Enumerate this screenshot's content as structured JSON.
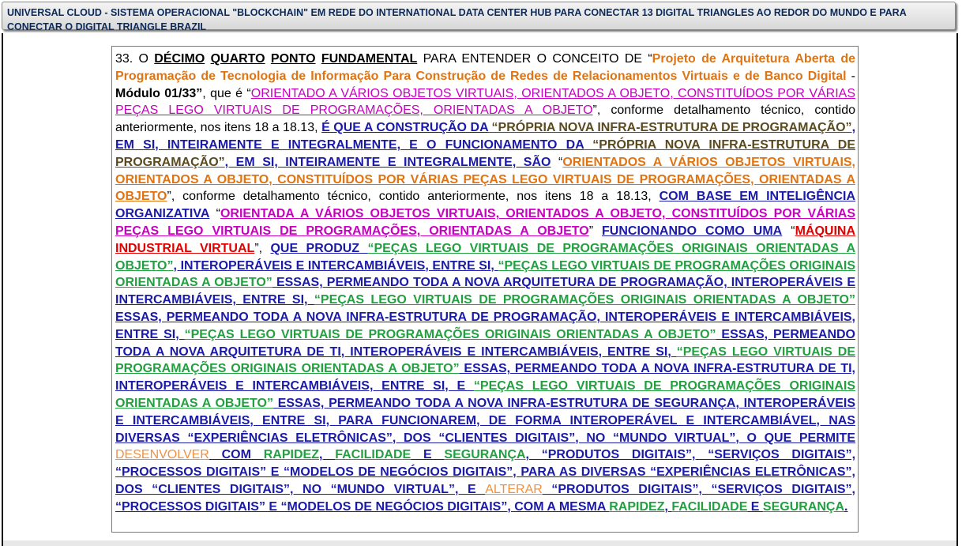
{
  "header": {
    "title": "UNIVERSAL CLOUD - SISTEMA OPERACIONAL \"BLOCKCHAIN\" EM REDE DO INTERNATIONAL DATA CENTER HUB PARA CONECTAR 13 DIGITAL TRIANGLES AO REDOR DO MUNDO E PARA CONECTAR O DIGITAL TRIANGLE BRAZIL"
  },
  "document": {
    "segments": [
      {
        "style": "plain",
        "text": "33.    O "
      },
      {
        "style": "plainu",
        "text": "DÉCIMO"
      },
      {
        "style": "plain",
        "text": " "
      },
      {
        "style": "plainu",
        "text": "QUARTO"
      },
      {
        "style": "plain",
        "text": " "
      },
      {
        "style": "plainu",
        "text": "PONTO"
      },
      {
        "style": "plain",
        "text": " "
      },
      {
        "style": "plainu",
        "text": "FUNDAMENTAL"
      },
      {
        "style": "plain",
        "text": " PARA ENTENDER O CONCEITO DE “"
      },
      {
        "style": "orangeb",
        "text": "Projeto de Arquitetura Aberta de Programação de Tecnologia de Informação Para Construção de Redes de Relacionamentos Virtuais e de Banco Digital"
      },
      {
        "style": "plain",
        "text": " - "
      },
      {
        "style": "bold",
        "text": "Módulo 01/33”"
      },
      {
        "style": "plain",
        "text": ", que é “"
      },
      {
        "style": "magenta",
        "text": "ORIENTADO A VÁRIOS OBJETOS VIRTUAIS, ORIENTADOS A OBJETO, CONSTITUÍDOS POR VÁRIAS PEÇAS LEGO VIRTUAIS DE PROGRAMAÇÕES, ORIENTADAS A OBJETO"
      },
      {
        "style": "plain",
        "text": "”, conforme detalhamento técnico, contido anteriormente, nos itens 18 a 18.13, "
      },
      {
        "style": "blue",
        "text": "É QUE A CONSTRUÇÃO DA"
      },
      {
        "style": "olive",
        "text": " “PRÓPRIA NOVA INFRA-ESTRUTURA DE PROGRAMAÇÃO”"
      },
      {
        "style": "blue",
        "text": ", EM SI, INTEIRAMENTE E INTEGRALMENTE, E O FUNCIONAMENTO DA"
      },
      {
        "style": "olive",
        "text": " “PRÓPRIA NOVA INFRA-ESTRUTURA DE PROGRAMAÇÃO”"
      },
      {
        "style": "blue",
        "text": ", EM SI, INTEIRAMENTE E INTEGRALMENTE, SÃO"
      },
      {
        "style": "plain",
        "text": " “"
      },
      {
        "style": "orange",
        "text": "ORIENTADOS A VÁRIOS OBJETOS VIRTUAIS, ORIENTADOS A OBJETO, CONSTITUÍDOS POR VÁRIAS PEÇAS LEGO VIRTUAIS DE PROGRAMAÇÕES, ORIENTADAS A OBJETO"
      },
      {
        "style": "plain",
        "text": "”, conforme detalhamento técnico, contido anteriormente, nos itens 18 a 18.13, "
      },
      {
        "style": "blue",
        "text": "COM BASE EM INTELIGÊNCIA ORGANIZATIVA"
      },
      {
        "style": "plain",
        "text": " “"
      },
      {
        "style": "magentab",
        "text": "ORIENTADA A VÁRIOS OBJETOS VIRTUAIS, ORIENTADOS A OBJETO, CONSTITUÍDOS POR VÁRIAS PEÇAS LEGO VIRTUAIS DE PROGRAMAÇÕES, ORIENTADAS A OBJETO"
      },
      {
        "style": "plain",
        "text": "” "
      },
      {
        "style": "blue",
        "text": "FUNCIONANDO COMO UMA"
      },
      {
        "style": "plain",
        "text": " “"
      },
      {
        "style": "red",
        "text": "MÁQUINA INDUSTRIAL VIRTUAL"
      },
      {
        "style": "plain",
        "text": "”, "
      },
      {
        "style": "blue",
        "text": "QUE PRODUZ "
      },
      {
        "style": "green",
        "text": "“PEÇAS LEGO VIRTUAIS DE PROGRAMAÇÕES ORIGINAIS ORIENTADAS A OBJETO”"
      },
      {
        "style": "blue",
        "text": ", INTEROPERÁVEIS E INTERCAMBIÁVEIS, ENTRE SI, "
      },
      {
        "style": "green",
        "text": "“PEÇAS LEGO VIRTUAIS DE PROGRAMAÇÕES ORIGINAIS ORIENTADAS A OBJETO”"
      },
      {
        "style": "blue",
        "text": " ESSAS, PERMEANDO TODA A NOVA ARQUITETURA DE PROGRAMAÇÃO, INTEROPERÁVEIS E INTERCAMBIÁVEIS, ENTRE SI, "
      },
      {
        "style": "green",
        "text": "“PEÇAS LEGO VIRTUAIS DE PROGRAMAÇÕES ORIGINAIS ORIENTADAS A OBJETO”"
      },
      {
        "style": "blue",
        "text": " ESSAS, PERMEANDO TODA A NOVA INFRA-ESTRUTURA DE PROGRAMAÇÃO, INTEROPERÁVEIS E INTERCAMBIÁVEIS, ENTRE SI, "
      },
      {
        "style": "green",
        "text": "“PEÇAS LEGO VIRTUAIS DE PROGRAMAÇÕES ORIGINAIS ORIENTADAS A OBJETO”"
      },
      {
        "style": "blue",
        "text": " ESSAS, PERMEANDO TODA A NOVA ARQUITETURA DE TI, INTEROPERÁVEIS E INTERCAMBIÁVEIS, ENTRE SI, "
      },
      {
        "style": "green",
        "text": "“PEÇAS LEGO VIRTUAIS DE PROGRAMAÇÕES ORIGINAIS ORIENTADAS A OBJETO”"
      },
      {
        "style": "blue",
        "text": " ESSAS, PERMEANDO TODA A NOVA INFRA-ESTRUTURA DE TI, INTEROPERÁVEIS E INTERCAMBIÁVEIS, ENTRE SI, E "
      },
      {
        "style": "green",
        "text": "“PEÇAS LEGO VIRTUAIS DE PROGRAMAÇÕES ORIGINAIS ORIENTADAS A OBJETO”"
      },
      {
        "style": "blue",
        "text": " ESSAS, PERMEANDO TODA A NOVA INFRA-ESTRUTURA DE SEGURANÇA, INTEROPERÁVEIS E INTERCAMBIÁVEIS, ENTRE SI, PARA FUNCIONAREM, DE FORMA INTEROPERÁVEL E INTERCAMBIÁVEL, NAS DIVERSAS “EXPERIÊNCIAS ELETRÔNICAS”, DOS “CLIENTES DIGITAIS”, NO “MUNDO VIRTUAL”, O QUE PERMITE "
      },
      {
        "style": "lorange",
        "text": "DESENVOLVER"
      },
      {
        "style": "blue",
        "text": " COM "
      },
      {
        "style": "green",
        "text": "RAPIDEZ"
      },
      {
        "style": "blue",
        "text": ", "
      },
      {
        "style": "green",
        "text": "FACILIDADE"
      },
      {
        "style": "blue",
        "text": " E "
      },
      {
        "style": "green",
        "text": "SEGURANÇA"
      },
      {
        "style": "blue",
        "text": ", “PRODUTOS DIGITAIS”, “SERVIÇOS DIGITAIS”, “PROCESSOS DIGITAIS” E “MODELOS DE NEGÓCIOS DIGITAIS”, PARA AS DIVERSAS “EXPERIÊNCIAS ELETRÔNICAS”, DOS “CLIENTES DIGITAIS”, NO “MUNDO VIRTUAL”, E "
      },
      {
        "style": "lorange",
        "text": "ALTERAR"
      },
      {
        "style": "blue",
        "text": " “PRODUTOS DIGITAIS”, “SERVIÇOS DIGITAIS”, “PROCESSOS DIGITAIS” E “MODELOS DE NEGÓCIOS DIGITAIS”, COM A MESMA "
      },
      {
        "style": "green",
        "text": "RAPIDEZ"
      },
      {
        "style": "blue",
        "text": ", "
      },
      {
        "style": "green",
        "text": "FACILIDADE"
      },
      {
        "style": "blue",
        "text": " E "
      },
      {
        "style": "green",
        "text": "SEGURANÇA"
      },
      {
        "style": "blue",
        "text": "."
      }
    ]
  },
  "colors": {
    "title_text": "#0b2a5c",
    "blue_text": "#1a1aa8",
    "magenta_text": "#c800c0",
    "orange_text": "#e07412",
    "green_text": "#22a040",
    "red_text": "#e00000",
    "olive_text": "#5a4a1e"
  }
}
